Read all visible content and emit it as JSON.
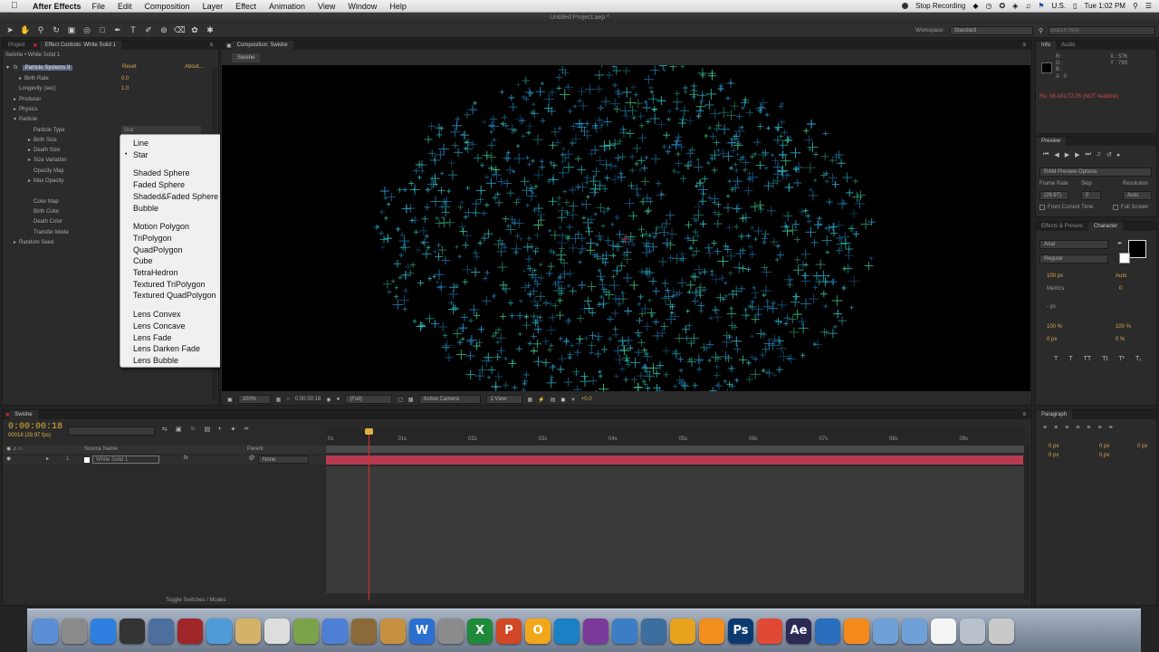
{
  "menubar": {
    "app": "After Effects",
    "items": [
      "File",
      "Edit",
      "Composition",
      "Layer",
      "Effect",
      "Animation",
      "View",
      "Window",
      "Help"
    ],
    "status": [
      "Stop Recording",
      "U.S.",
      "Tue 1:02 PM"
    ]
  },
  "window": {
    "title": "Untitled Project.aep *"
  },
  "toolbar": {
    "workspace_label": "Workspace:",
    "workspace_value": "Standard",
    "search_placeholder": "Search Help"
  },
  "left_panel": {
    "tabs": [
      "Project",
      "Effect Controls: White Solid 1"
    ],
    "layer_path": "Swishe • White Solid 1",
    "effect_name": "Particle Systems II",
    "reset": "Reset",
    "about": "About...",
    "rows": [
      {
        "label": "Birth Rate",
        "value": "0.0"
      },
      {
        "label": "Longevity (sec)",
        "value": "1.0"
      },
      {
        "label": "Producer",
        "value": ""
      },
      {
        "label": "Physics",
        "value": ""
      },
      {
        "label": "Particle",
        "value": ""
      },
      {
        "label": "Particle Type",
        "value": "Star"
      },
      {
        "label": "Birth Size",
        "value": ""
      },
      {
        "label": "Death Size",
        "value": ""
      },
      {
        "label": "Size Variation",
        "value": ""
      },
      {
        "label": "Opacity Map",
        "value": ""
      },
      {
        "label": "Max Opacity",
        "value": ""
      },
      {
        "label": "",
        "value": ""
      },
      {
        "label": "Color Map",
        "value": ""
      },
      {
        "label": "Birth Color",
        "value": ""
      },
      {
        "label": "Death Color",
        "value": ""
      },
      {
        "label": "Transfer Mode",
        "value": ""
      },
      {
        "label": "Random Seed",
        "value": ""
      }
    ]
  },
  "particle_type_menu": {
    "selected": "Star",
    "groups": [
      [
        "Line",
        "Star"
      ],
      [
        "Shaded Sphere",
        "Faded Sphere",
        "Shaded&Faded Sphere",
        "Bubble"
      ],
      [
        "Motion Polygon",
        "TriPolygon",
        "QuadPolygon",
        "Cube",
        "TetraHedron",
        "Textured TriPolygon",
        "Textured QuadPolygon"
      ],
      [
        "Lens Convex",
        "Lens Concave",
        "Lens Fade",
        "Lens Darken Fade",
        "Lens Bubble"
      ]
    ]
  },
  "composition": {
    "tab": "Composition: Swishe",
    "subtab": "Swishe",
    "footer": {
      "zoom": "100%",
      "timecode": "0:00:00:18",
      "resolution": "(Full)",
      "camera": "Active Camera",
      "view": "1 View",
      "exposure": "+0.0"
    }
  },
  "info_panel": {
    "tabs": [
      "Info",
      "Audio"
    ],
    "r": "R :",
    "g": "G :",
    "b": "B :",
    "a": "A : 0",
    "x": "X : 576",
    "y": "Y : 799",
    "warning": "Re: 98.431/72.05 (NOT realtime)"
  },
  "preview_panel": {
    "tab": "Preview",
    "ram_options": "RAM Preview Options",
    "frame_rate_label": "Frame Rate",
    "skip_label": "Skip",
    "resolution_label": "Resolution",
    "frame_rate": "(29.97)",
    "skip": "0",
    "resolution": "Auto",
    "from_current": "From Current Time",
    "full_screen": "Full Screen"
  },
  "character_panel": {
    "tabs": [
      "Effects & Presets",
      "Character"
    ],
    "font": "Arial",
    "style": "Regular",
    "size": "100 px",
    "leading": "Auto",
    "kerning": "Metrics",
    "tracking": "0",
    "stroke": "- px",
    "vscale": "100 %",
    "hscale": "100 %",
    "baseline": "0 px",
    "tsume": "0 %"
  },
  "paragraph_panel": {
    "tab": "Paragraph",
    "values": [
      "0 px",
      "0 px",
      "0 px",
      "0 px",
      "0 px"
    ]
  },
  "timeline": {
    "tab": "Swishe",
    "timecode": "0:00:00:18",
    "fps": "00018 (29.97 fps)",
    "col_source": "Source Name",
    "col_parent": "Parent",
    "layer_num": "1",
    "layer_name": "White Solid 1",
    "parent_value": "None",
    "toggle_label": "Toggle Switches / Modes",
    "ruler": [
      "0s",
      "01s",
      "02s",
      "03s",
      "04s",
      "05s",
      "06s",
      "07s",
      "08s",
      "09s"
    ],
    "playhead_seconds": 0.6
  },
  "dock": {
    "icons": [
      "finder-icon",
      "system-prefs-icon",
      "app-store-icon",
      "dashboard-icon",
      "preview-icon",
      "photobooth-icon",
      "facetime-icon",
      "notes-icon",
      "calendar-icon",
      "photos-icon",
      "itunes-icon",
      "iphoto-icon",
      "garageband-icon",
      "word-icon",
      "quicktime-icon",
      "excel-icon",
      "powerpoint-icon",
      "outlook-icon",
      "lync-icon",
      "onenote-icon",
      "network-icon",
      "xcode-icon",
      "sketchup-icon",
      "pages-icon",
      "photoshop-icon",
      "chrome-icon",
      "aftereffects-icon",
      "quicktime-player-icon",
      "vlc-icon",
      "folder-icon",
      "downloads-icon",
      "document-icon",
      "drive-icon",
      "trash-icon"
    ],
    "labels": {
      "photoshop-icon": "Ps",
      "aftereffects-icon": "Ae",
      "word-icon": "W",
      "excel-icon": "X",
      "powerpoint-icon": "P",
      "outlook-icon": "O"
    }
  }
}
